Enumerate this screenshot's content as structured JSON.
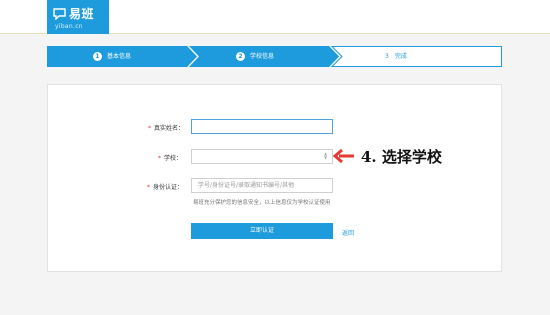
{
  "header": {
    "logo_name": "易班",
    "logo_domain": "yiban.cn"
  },
  "steps": [
    {
      "num": "1",
      "label": "基本信息",
      "state": "done"
    },
    {
      "num": "2",
      "label": "学校信息",
      "state": "active"
    },
    {
      "num": "3",
      "label": "完成",
      "state": "pending"
    }
  ],
  "form": {
    "name_label": "真实姓名：",
    "name_value": "",
    "school_label": "学校：",
    "school_value": "",
    "id_label": "身份认证：",
    "id_placeholder": "学号/身份证号/录取通知书编号/其他",
    "id_hint": "易班充分保护您的信息安全，以上信息仅为学校认证使用",
    "required_mark": "*",
    "submit_label": "立即认证",
    "back_label": "返回"
  },
  "annotation": {
    "text": "4. 选择学校",
    "color": "#e53935"
  },
  "colors": {
    "brand": "#1e9bdc",
    "header_bg": "#ffffff",
    "page_bg": "#f4f4f4"
  }
}
